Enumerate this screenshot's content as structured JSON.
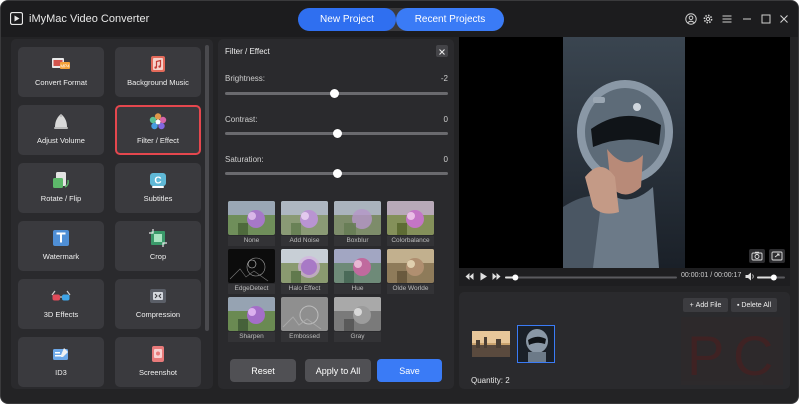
{
  "app": {
    "title": "iMyMac Video Converter"
  },
  "top_tabs": {
    "new_project": "New Project",
    "recent_projects": "Recent Projects"
  },
  "tools": [
    {
      "label": "Convert Format",
      "icon": "convert-format-icon"
    },
    {
      "label": "Background Music",
      "icon": "music-icon"
    },
    {
      "label": "Adjust Volume",
      "icon": "volume-icon"
    },
    {
      "label": "Filter / Effect",
      "icon": "filter-icon",
      "active": true
    },
    {
      "label": "Rotate / Flip",
      "icon": "rotate-icon"
    },
    {
      "label": "Subtitles",
      "icon": "subtitles-icon"
    },
    {
      "label": "Watermark",
      "icon": "watermark-icon"
    },
    {
      "label": "Crop",
      "icon": "crop-icon"
    },
    {
      "label": "3D Effects",
      "icon": "3d-glasses-icon"
    },
    {
      "label": "Compression",
      "icon": "compression-icon"
    },
    {
      "label": "ID3",
      "icon": "id3-icon"
    },
    {
      "label": "Screenshot",
      "icon": "screenshot-icon"
    }
  ],
  "filter_panel": {
    "title": "Filter / Effect",
    "sliders": [
      {
        "label": "Brightness:",
        "value": "-2",
        "level": 0.49
      },
      {
        "label": "Contrast:",
        "value": "0",
        "level": 0.5
      },
      {
        "label": "Saturation:",
        "value": "0",
        "level": 0.5
      }
    ],
    "effects": [
      "None",
      "Add Noise",
      "Boxblur",
      "Colorbalance",
      "EdgeDetect",
      "Halo Effect",
      "Hue",
      "Olde Worlde",
      "Sharpen",
      "Embossed",
      "Gray"
    ],
    "buttons": {
      "reset": "Reset",
      "apply_all": "Apply to All",
      "save": "Save"
    }
  },
  "player": {
    "time": "00:00:01 / 00:00:17",
    "progress": 0.06,
    "volume": 0.6
  },
  "files": {
    "add_file": "Add File",
    "delete_all": "Delete All",
    "quantity": "Quantity: 2"
  },
  "colors": {
    "accent": "#3a7bf6",
    "active_border": "#e5474e",
    "background": "#232325",
    "panel": "#2a2a2d"
  }
}
